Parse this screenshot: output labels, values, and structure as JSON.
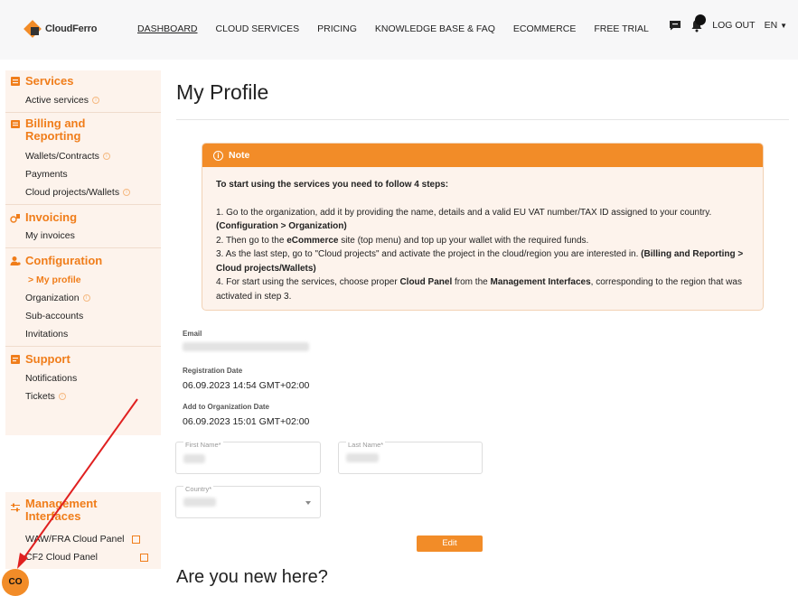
{
  "brand": {
    "name": "CloudFerro",
    "accent": "#f28c28"
  },
  "nav": {
    "items": [
      "DASHBOARD",
      "CLOUD SERVICES",
      "PRICING",
      "KNOWLEDGE BASE & FAQ",
      "ECOMMERCE",
      "FREE TRIAL"
    ],
    "logout": "LOG OUT",
    "language": "EN"
  },
  "sidebar": {
    "services": {
      "title": "Services",
      "items": [
        "Active services"
      ]
    },
    "billing": {
      "title_line1": "Billing and",
      "title_line2": "Reporting",
      "items": [
        "Wallets/Contracts",
        "Payments",
        "Cloud projects/Wallets"
      ]
    },
    "invoicing": {
      "title": "Invoicing",
      "items": [
        "My invoices"
      ]
    },
    "configuration": {
      "title": "Configuration",
      "selected": "> My profile",
      "items": [
        "Organization",
        "Sub-accounts",
        "Invitations"
      ]
    },
    "support": {
      "title": "Support",
      "items": [
        "Notifications",
        "Tickets"
      ]
    },
    "management": {
      "title_line1": "Management",
      "title_line2": "Interfaces",
      "items": [
        "WAW/FRA Cloud Panel",
        "CF2 Cloud Panel"
      ]
    }
  },
  "page": {
    "title": "My Profile",
    "note": {
      "heading": "Note",
      "intro": "To start using the services you need to follow 4 steps:",
      "step1": "1. Go to the organization, add it by providing the name, details and a valid EU VAT number/TAX ID assigned to your country.",
      "step1_bold": "(Configuration > Organization)",
      "step2_pre": "2. Then go to the",
      "step2_bold": "eCommerce",
      "step2_post": "site (top menu) and top up your wallet with the required funds.",
      "step3": "3. As the last step, go to \"Cloud projects\" and activate the project in the cloud/region you are interested in.",
      "step3_bold": "(Billing and Reporting > Cloud projects/Wallets)",
      "step4_pre": "4. For start using the services, choose proper",
      "step4_bold1": "Cloud Panel",
      "step4_mid": "from the",
      "step4_bold2": "Management Interfaces",
      "step4_post": ", corresponding to the region that was activated in step 3."
    },
    "email_label": "Email",
    "registration_label": "Registration Date",
    "registration_value": "06.09.2023 14:54 GMT+02:00",
    "org_date_label": "Add to Organization Date",
    "org_date_value": "06.09.2023 15:01 GMT+02:00",
    "first_name_label": "First Name*",
    "last_name_label": "Last Name*",
    "country_label": "Country*",
    "edit_button": "Edit",
    "new_here": "Are you new here?"
  },
  "floating_button": "CO"
}
